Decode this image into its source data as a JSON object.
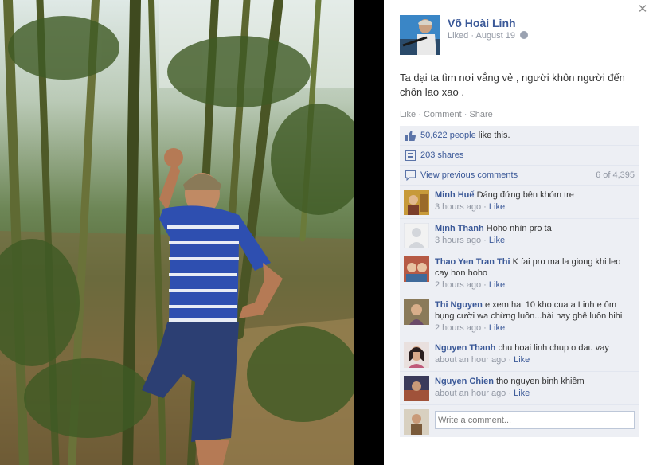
{
  "photo": {
    "subject": ""
  },
  "post": {
    "author": "Võ Hoài Linh",
    "status": "Liked",
    "date": "August 19",
    "privacy_icon": "globe-icon",
    "caption": "Ta dại ta tìm nơi vắng vẻ , người khôn người đến chốn lao xao .",
    "actions": {
      "like": "Like",
      "comment": "Comment",
      "share": "Share",
      "sep": " · "
    }
  },
  "stats": {
    "likes": "50,622 people",
    "likes_suffix": " like this.",
    "shares": "203 shares",
    "view_previous": "View previous comments",
    "comment_count": "6 of 4,395"
  },
  "comments": [
    {
      "name": "Minh Huế",
      "text": "Dáng đứng bên khóm tre",
      "time": "3 hours ago",
      "like": "Like"
    },
    {
      "name": "Mịnh Thanh",
      "text": "Hoho nhìn pro ta",
      "time": "3 hours ago",
      "like": "Like"
    },
    {
      "name": "Thao Yen Tran Thi",
      "text": "K fai pro ma la giong khi leo cay hon hoho",
      "time": "2 hours ago",
      "like": "Like"
    },
    {
      "name": "Thi Nguyen",
      "text": "e xem hai 10 kho cua a Linh e ôm bụng cười wa chừng luôn...hài hay ghê luôn hihi",
      "time": "2 hours ago",
      "like": "Like"
    },
    {
      "name": "Nguyen Thanh",
      "text": "chu hoai linh chup o dau vay",
      "time": "about an hour ago",
      "like": "Like"
    },
    {
      "name": "Nguyen Chien",
      "text": "tho nguyen binh khiêm",
      "time": "about an hour ago",
      "like": "Like"
    }
  ],
  "composer": {
    "placeholder": "Write a comment..."
  },
  "colors": {
    "link": "#3b5998",
    "ufi_bg": "#edeff4",
    "muted": "#9197a3"
  }
}
